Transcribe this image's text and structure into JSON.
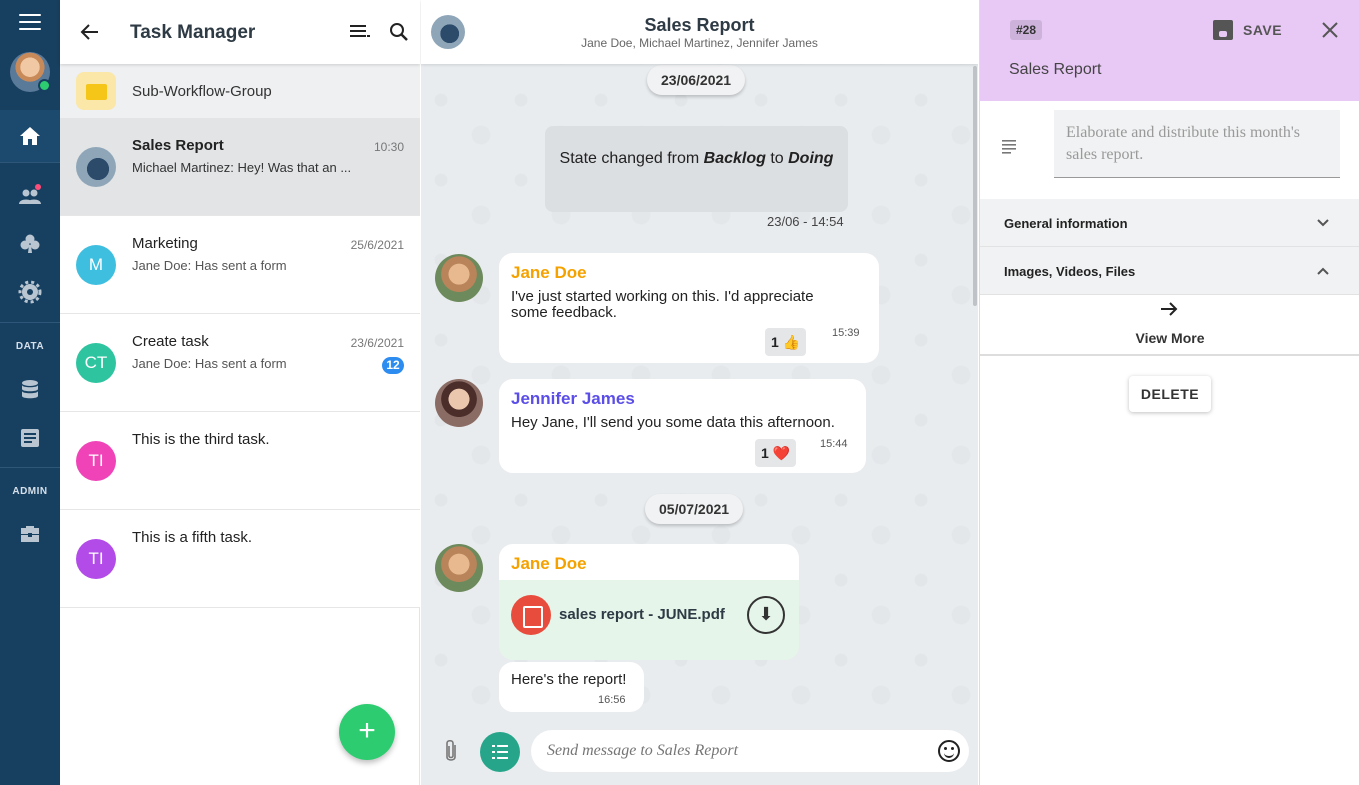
{
  "task_list": {
    "title": "Task Manager",
    "group": {
      "label": "Sub-Workflow-Group"
    },
    "items": [
      {
        "name": "Sales Report",
        "subtitle": "Michael Martinez: Hey! Was that an ...",
        "time": "10:30",
        "avatar_color": "#8fa6b8"
      },
      {
        "name": "Marketing",
        "subtitle": "Jane Doe: Has sent a form",
        "time": "25/6/2021",
        "initials": "M",
        "avatar_color": "#3fbfe0"
      },
      {
        "name": "Create task",
        "subtitle": "Jane Doe: Has sent a form",
        "time": "23/6/2021",
        "initials": "CT",
        "badge": "12",
        "avatar_color": "#2ec4a0"
      },
      {
        "name": "This is the third task.",
        "initials": "TI",
        "avatar_color": "#f043b8"
      },
      {
        "name": "This is a fifth task.",
        "initials": "TI",
        "avatar_color": "#b24be8"
      }
    ],
    "fab_label": "+"
  },
  "nav": {
    "section_data": "DATA",
    "section_admin": "ADMIN"
  },
  "chat": {
    "title": "Sales Report",
    "members": "Jane Doe, Michael Martinez, Jennifer James",
    "date1": "23/06/2021",
    "state_change": {
      "prefix": "State changed from ",
      "from": "Backlog",
      "mid": " to ",
      "to": "Doing"
    },
    "state_time": "23/06 - 14:54",
    "messages": [
      {
        "author": "Jane Doe",
        "author_color": "#f5a200",
        "text_line1": "I've just started working on this. I'd appreciate",
        "text_line2": "some feedback.",
        "time": "15:39",
        "reaction": "1 👍"
      },
      {
        "author": "Jennifer James",
        "author_color": "#5b4ee8",
        "text": "Hey Jane, I'll send you some data this afternoon.",
        "time": "15:44",
        "reaction": "1 ❤️"
      }
    ],
    "date2": "05/07/2021",
    "file_message": {
      "author": "Jane Doe",
      "author_color": "#f5a200",
      "file_name": "sales report - JUNE.pdf"
    },
    "text_message": {
      "text": "Here's the report!",
      "time": "16:56"
    },
    "composer_placeholder": "Send message to Sales Report"
  },
  "detail": {
    "id": "#28",
    "save_label": "SAVE",
    "task_name": "Sales Report",
    "description": "Elaborate and distribute this month's sales report.",
    "sections": [
      "General information",
      "Images, Videos, Files"
    ],
    "view_more": "View More",
    "delete_label": "DELETE"
  }
}
